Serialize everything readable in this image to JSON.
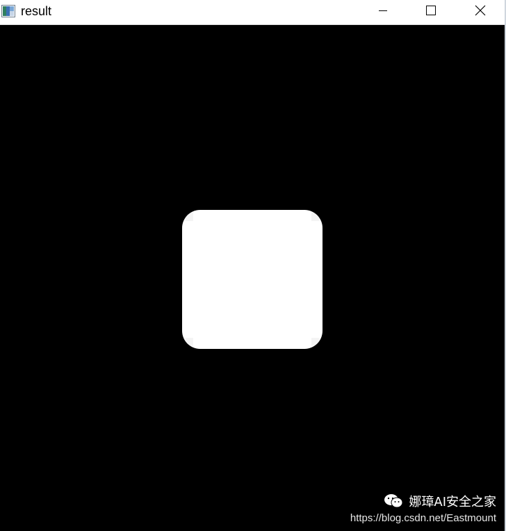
{
  "window": {
    "title": "result",
    "icons": {
      "app": "image-window-icon",
      "minimize": "minimize-icon",
      "maximize": "maximize-icon",
      "close": "close-icon"
    }
  },
  "canvas": {
    "background": "#000000",
    "shape_color": "#ffffff"
  },
  "watermark": {
    "brand": "娜璋AI安全之家",
    "url": "https://blog.csdn.net/Eastmount",
    "icon": "wechat-icon"
  }
}
